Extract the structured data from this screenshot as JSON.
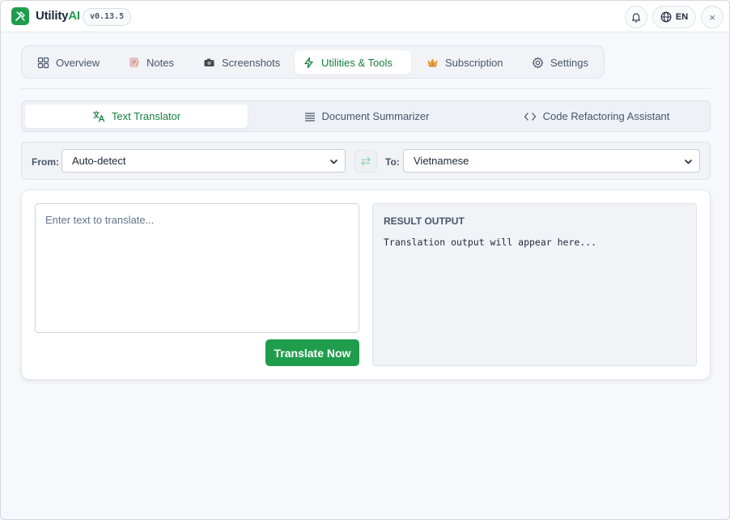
{
  "app": {
    "brand_main": "Utility",
    "brand_accent": "AI",
    "version": "v0.13.5",
    "language": "EN",
    "close_symbol": "×"
  },
  "nav": {
    "tabs": [
      {
        "label": "Overview",
        "icon": "grid-icon"
      },
      {
        "label": "Notes",
        "icon": "notes-icon"
      },
      {
        "label": "Screenshots",
        "icon": "camera-icon"
      },
      {
        "label": "Utilities & Tools",
        "icon": "lightning-icon",
        "active": true
      },
      {
        "label": "Subscription",
        "icon": "crown-icon"
      },
      {
        "label": "Settings",
        "icon": "gear-icon"
      }
    ]
  },
  "subtabs": [
    {
      "label": "Text Translator",
      "icon": "translate-icon",
      "active": true
    },
    {
      "label": "Document Summarizer",
      "icon": "lines-icon"
    },
    {
      "label": "Code Refactoring Assistant",
      "icon": "code-icon"
    }
  ],
  "translator": {
    "from_label": "From:",
    "from_value": "Auto-detect",
    "to_label": "To:",
    "to_value": "Vietnamese",
    "input_placeholder": "Enter text to translate...",
    "button_label": "Translate Now",
    "result_title": "RESULT OUTPUT",
    "result_placeholder": "Translation output will appear here..."
  },
  "colors": {
    "accent": "#1f9d4c",
    "active_text": "#15803d",
    "background": "#f7f8fb"
  }
}
